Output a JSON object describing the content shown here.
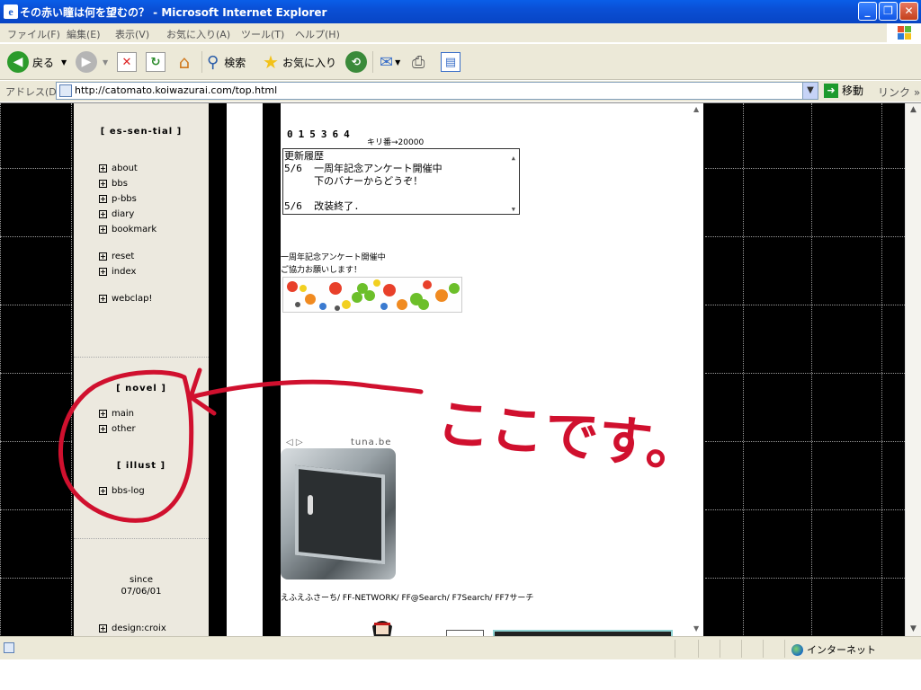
{
  "window": {
    "title": "その赤い瞳は何を望むの？ - Microsoft Internet Explorer",
    "buttons": {
      "minimize": "_",
      "maximize": "❐",
      "close": "✕"
    }
  },
  "menu": [
    "ファイル(F)",
    "編集(E)",
    "表示(V)",
    "お気に入り(A)",
    "ツール(T)",
    "ヘルプ(H)"
  ],
  "toolbar": {
    "back_label": "戻る",
    "search_label": "検索",
    "favorites_label": "お気に入り"
  },
  "address": {
    "label": "アドレス(D)",
    "url": "http://catomato.koiwazurai.com/top.html",
    "go_label": "移動",
    "links_label": "リンク"
  },
  "sidebar": {
    "essential_title": "[ es-sen-tial ]",
    "essential_items": [
      "about",
      "bbs",
      "p-bbs",
      "diary",
      "bookmark"
    ],
    "util_items": [
      "reset",
      "index"
    ],
    "webclap": "webclap!",
    "novel_title": "[ novel ]",
    "novel_items": [
      "main",
      "other"
    ],
    "illust_title": "[ illust ]",
    "illust_items": [
      "bbs-log"
    ],
    "since_label": "since",
    "since_date": "07/06/01",
    "design": "design:croix"
  },
  "content": {
    "counter": "015364",
    "kiriban": "キリ番→20000",
    "news": {
      "heading": "更新履歴",
      "lines": [
        "5/6  一周年記念アンケート開催中",
        "     下のバナーからどうぞ！",
        "",
        "5/6  改装終了."
      ]
    },
    "announce_line1": "一周年記念アンケート開催中",
    "announce_line2": "ご協力お願いします！",
    "tuna_nav": "◁ ▷",
    "tuna_label": "tuna.be",
    "links_line": "えふえふさーち/ FF-NETWORK/ FF@Search/ F7Search/ FF7サーチ"
  },
  "annotation": {
    "text": "ここです。",
    "color": "#d0102e"
  },
  "status": {
    "zone": "インターネット"
  }
}
